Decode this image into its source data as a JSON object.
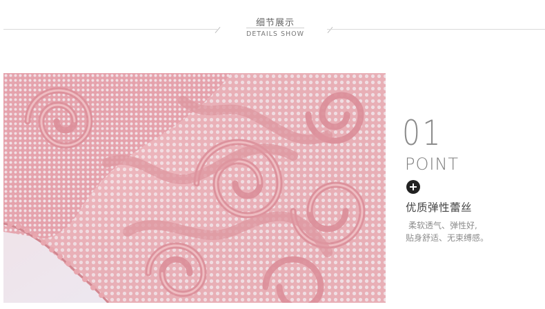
{
  "header": {
    "title_cn": "细节展示",
    "title_en": "DETAILS SHOW"
  },
  "photo": {
    "subject": "lace-fabric",
    "colors": {
      "lace": "#e7a2aa",
      "lace_dark": "#d27f8a",
      "background": "#ebe6ee"
    }
  },
  "detail": {
    "number": "01",
    "label": "POINT",
    "icon": "plus-circle-icon",
    "feature_title": "优质弹性蕾丝",
    "description_line1": "柔软透气、弹性好,",
    "description_line2": "贴身舒适、无束缚感。"
  }
}
